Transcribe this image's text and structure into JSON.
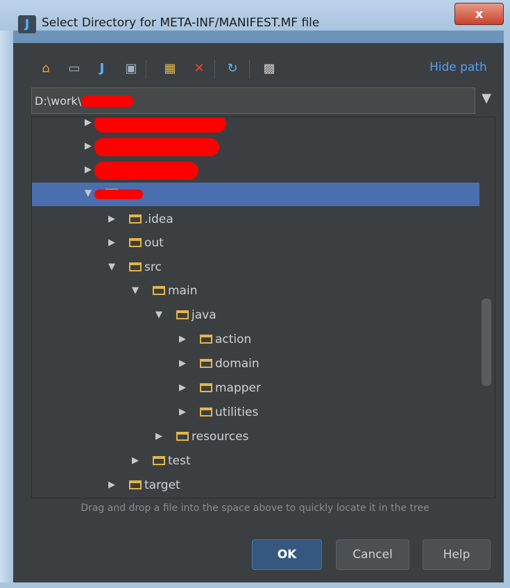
{
  "window": {
    "title": "Select Directory for META-INF/MANIFEST.MF file",
    "close_label": "x"
  },
  "toolbar": {
    "icons": [
      "home-icon",
      "desktop-icon",
      "project-icon",
      "module-icon",
      "new-folder-icon",
      "delete-icon",
      "refresh-icon",
      "show-hidden-icon"
    ],
    "hide_path_label": "Hide path"
  },
  "path": {
    "value": "D:\\work\\"
  },
  "tree": {
    "rows": [
      {
        "label": "",
        "expanded": false,
        "depth": 2,
        "redacted": true
      },
      {
        "label": "",
        "expanded": false,
        "depth": 2,
        "redacted": true
      },
      {
        "label": "",
        "expanded": false,
        "depth": 2,
        "redacted": true
      },
      {
        "label": "",
        "expanded": true,
        "depth": 2,
        "redacted": true,
        "selected": true
      },
      {
        "label": ".idea",
        "expanded": false,
        "depth": 3
      },
      {
        "label": "out",
        "expanded": false,
        "depth": 3
      },
      {
        "label": "src",
        "expanded": true,
        "depth": 3
      },
      {
        "label": "main",
        "expanded": true,
        "depth": 4
      },
      {
        "label": "java",
        "expanded": true,
        "depth": 5
      },
      {
        "label": "action",
        "expanded": false,
        "depth": 6
      },
      {
        "label": "domain",
        "expanded": false,
        "depth": 6
      },
      {
        "label": "mapper",
        "expanded": false,
        "depth": 6
      },
      {
        "label": "utilities",
        "expanded": false,
        "depth": 6
      },
      {
        "label": "resources",
        "expanded": false,
        "depth": 5
      },
      {
        "label": "test",
        "expanded": false,
        "depth": 4
      },
      {
        "label": "target",
        "expanded": false,
        "depth": 3
      }
    ]
  },
  "hint": "Drag and drop a file into the space above to quickly locate it in the tree",
  "buttons": {
    "ok": "OK",
    "cancel": "Cancel",
    "help": "Help"
  },
  "colors": {
    "selection": "#4b6eaf",
    "folder": "#e2b64a",
    "link": "#589df6",
    "background": "#3c3f41"
  }
}
